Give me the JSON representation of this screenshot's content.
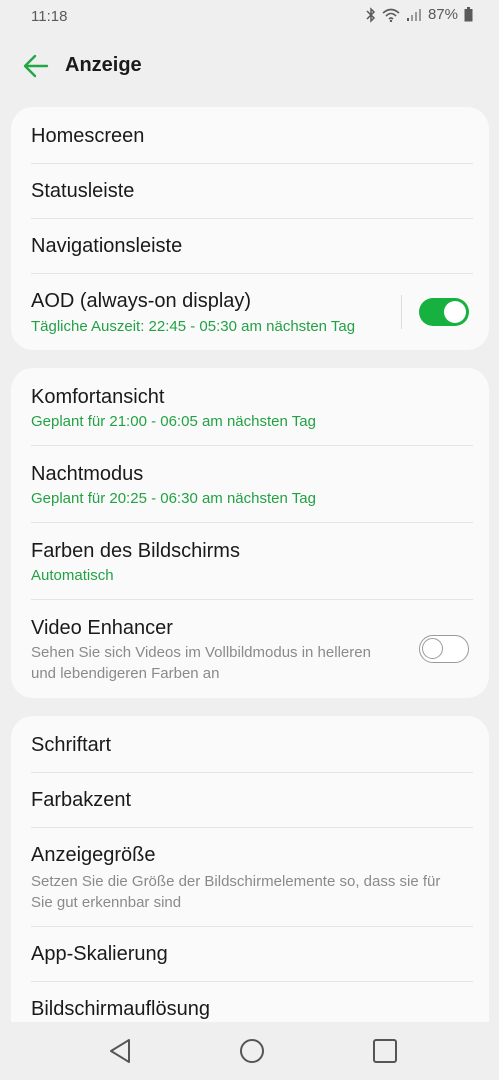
{
  "status_bar": {
    "time": "11:18",
    "battery_text": "87%",
    "icons": [
      "bluetooth-icon",
      "wifi-icon",
      "signal-icon",
      "battery-icon"
    ]
  },
  "app_bar": {
    "title": "Anzeige",
    "back_icon": "arrow-left-icon"
  },
  "accent_color": "#1fa844",
  "groups": [
    {
      "items": [
        {
          "label": "Homescreen"
        },
        {
          "label": "Statusleiste"
        },
        {
          "label": "Navigationsleiste"
        },
        {
          "label": "AOD (always-on display)",
          "subtitle": "Tägliche Auszeit: 22:45 - 05:30 am nächsten Tag",
          "toggle": "on"
        }
      ]
    },
    {
      "items": [
        {
          "label": "Komfortansicht",
          "subtitle": "Geplant für 21:00 - 06:05 am nächsten Tag"
        },
        {
          "label": "Nachtmodus",
          "subtitle": "Geplant für 20:25 - 06:30 am nächsten Tag"
        },
        {
          "label": "Farben des Bildschirms",
          "subtitle": "Automatisch"
        },
        {
          "label": "Video Enhancer",
          "description": "Sehen Sie sich Videos im Vollbildmodus in helleren und lebendigeren Farben an",
          "toggle": "off"
        }
      ]
    },
    {
      "items": [
        {
          "label": "Schriftart"
        },
        {
          "label": "Farbakzent"
        },
        {
          "label": "Anzeigegröße",
          "description": "Setzen Sie die Größe der Bildschirmelemente so, dass sie für Sie gut erkennbar sind"
        },
        {
          "label": "App-Skalierung"
        },
        {
          "label": "Bildschirmauflösung"
        }
      ]
    }
  ],
  "nav_bar": {
    "buttons": [
      "back-triangle-icon",
      "home-circle-icon",
      "recents-square-icon"
    ]
  }
}
